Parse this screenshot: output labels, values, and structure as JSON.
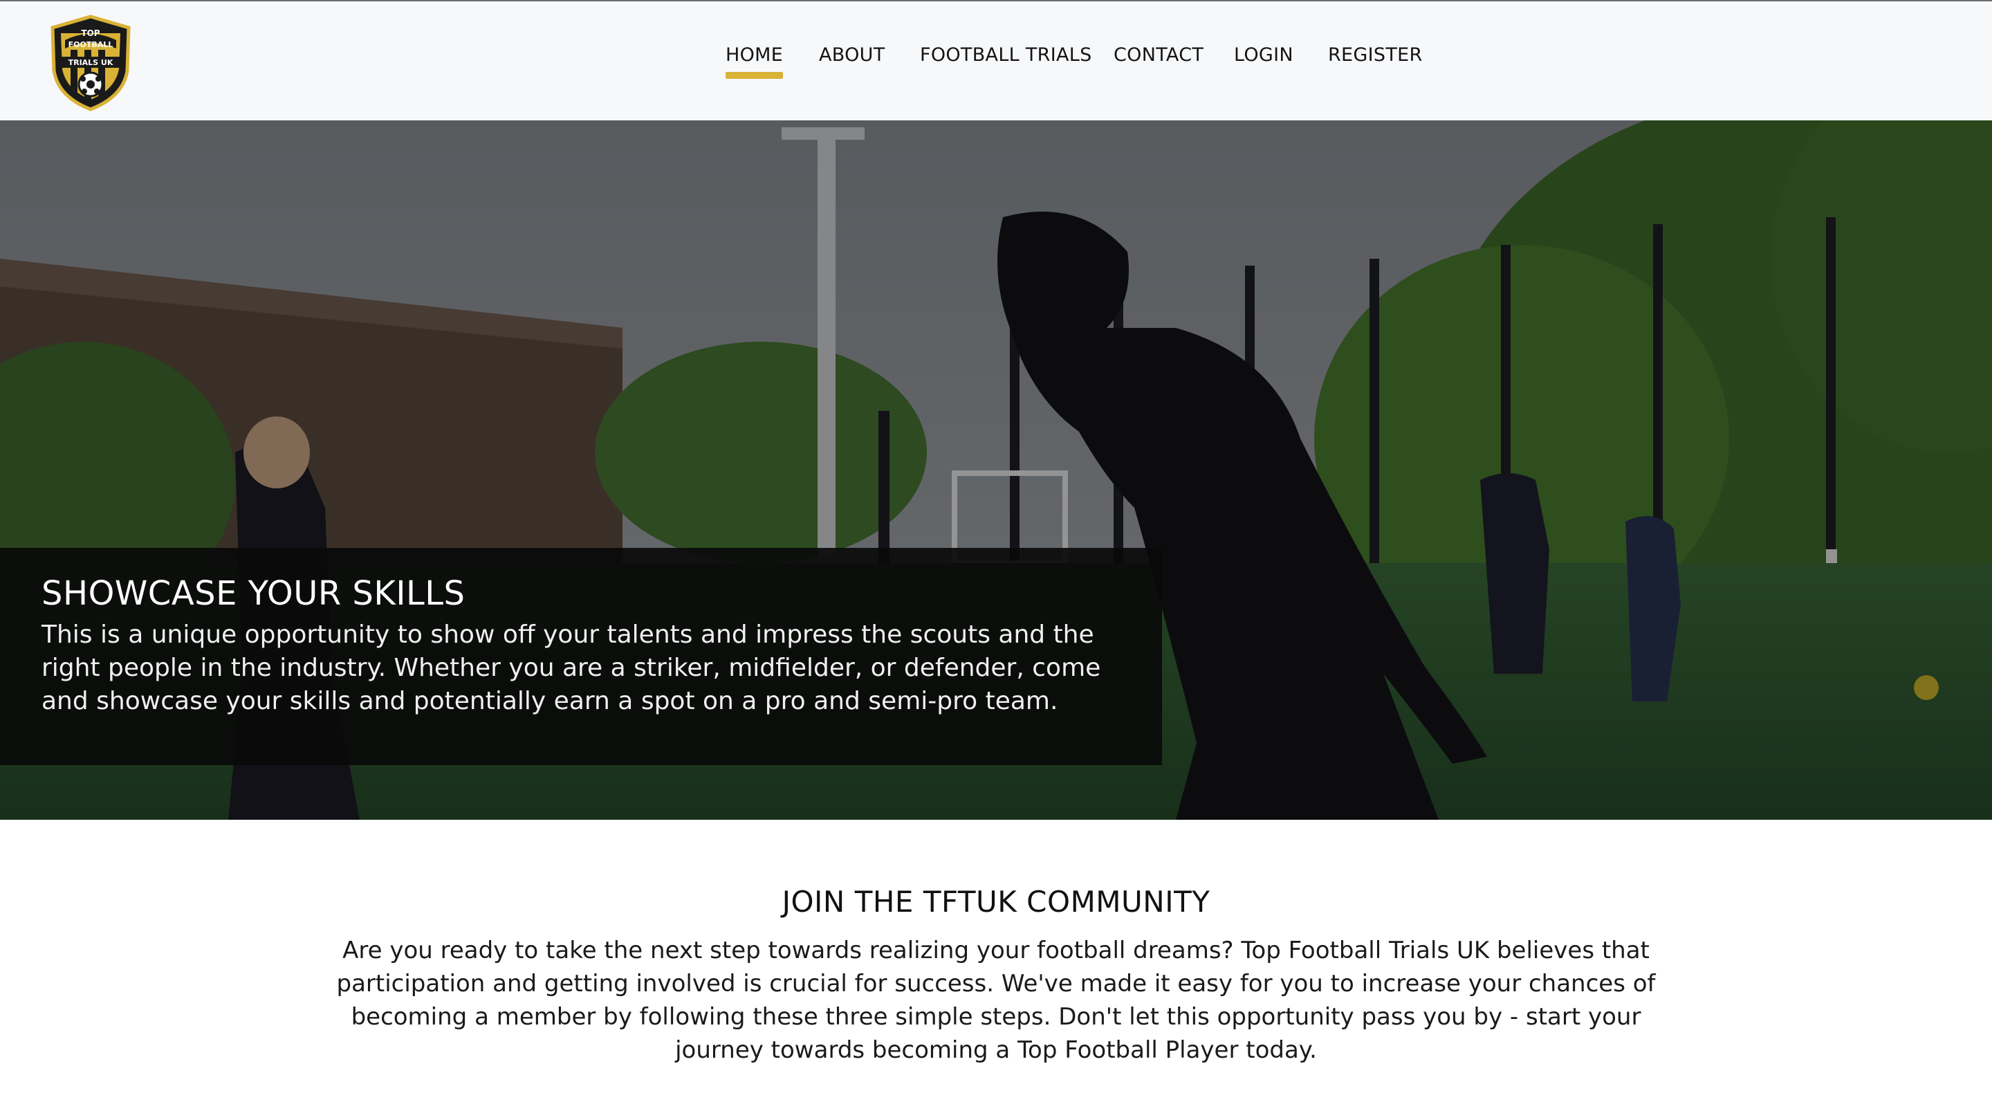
{
  "brand": {
    "logo_top": "TOP",
    "logo_mid": "FOOTBALL",
    "logo_bottom": "TRIALS UK",
    "accent_color": "#d9b236"
  },
  "nav": {
    "items": [
      {
        "label": "HOME",
        "active": true
      },
      {
        "label": "ABOUT",
        "active": false
      },
      {
        "label": "FOOTBALL TRIALS",
        "active": false
      },
      {
        "label": "CONTACT",
        "active": false
      },
      {
        "label": "LOGIN",
        "active": false
      },
      {
        "label": "REGISTER",
        "active": false
      }
    ]
  },
  "hero": {
    "title": "SHOWCASE YOUR SKILLS",
    "body": "This is a unique opportunity to show off your talents and impress the scouts and the right people in the industry. Whether you are a striker, midfielder, or defender, come and showcase your skills and potentially earn a spot on a pro and semi-pro team."
  },
  "community": {
    "title": "JOIN THE TFTUK COMMUNITY",
    "body": "Are you ready to take the next step towards realizing your football dreams? Top Football Trials UK believes that participation and getting involved is crucial for success. We've made it easy for you to increase your chances of becoming a member by following these three simple steps. Don't let this opportunity pass you by - start your journey towards becoming a Top Football Player today."
  }
}
